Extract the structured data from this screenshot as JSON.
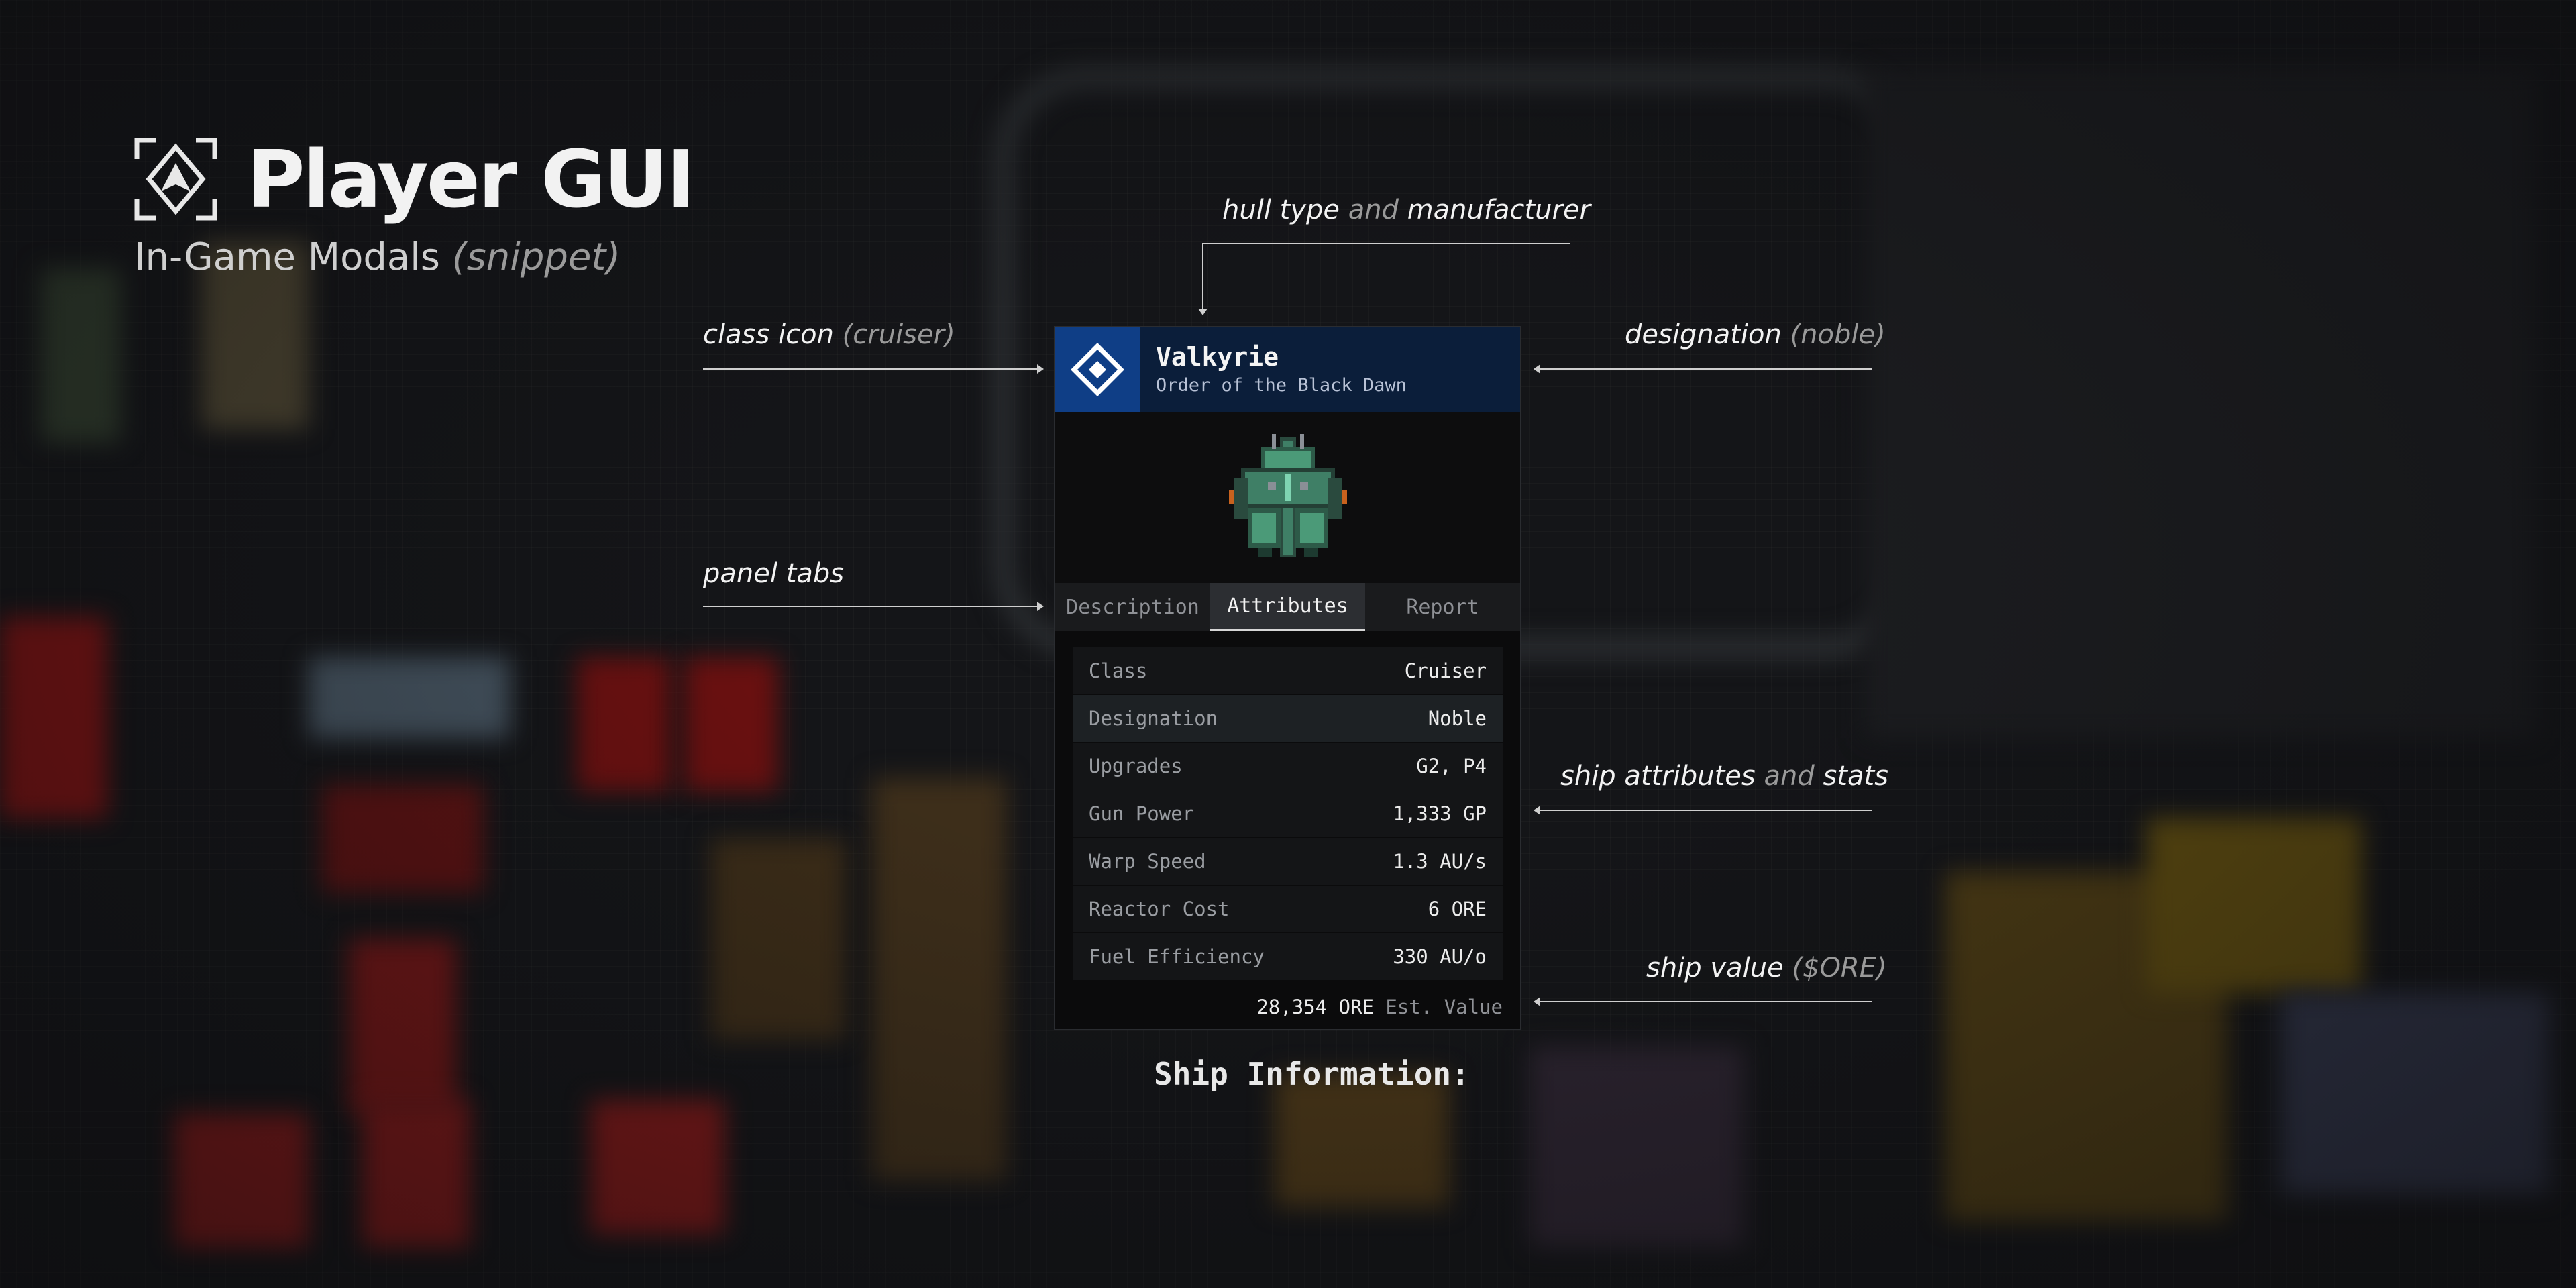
{
  "header": {
    "title": "Player GUI",
    "subtitle_main": "In-Game Modals",
    "subtitle_note": "(snippet)"
  },
  "annotations": {
    "hull": {
      "a": "hull type",
      "b": "and",
      "c": "manufacturer"
    },
    "class_icon": {
      "a": "class icon",
      "b": "(cruiser)"
    },
    "designation": {
      "a": "designation",
      "b": "(noble)"
    },
    "panel_tabs": {
      "a": "panel tabs"
    },
    "attributes": {
      "a": "ship attributes",
      "b": "and",
      "c": "stats"
    },
    "ship_value": {
      "a": "ship value",
      "b": "($ORE)"
    }
  },
  "modal": {
    "ship_name": "Valkyrie",
    "manufacturer": "Order of the Black Dawn",
    "tabs": [
      {
        "label": "Description",
        "active": false
      },
      {
        "label": "Attributes",
        "active": true
      },
      {
        "label": "Report",
        "active": false
      }
    ],
    "attributes": [
      {
        "label": "Class",
        "value": "Cruiser"
      },
      {
        "label": "Designation",
        "value": "Noble"
      },
      {
        "label": "Upgrades",
        "value": "G2, P4"
      },
      {
        "label": "Gun Power",
        "value": "1,333 GP"
      },
      {
        "label": "Warp Speed",
        "value": "1.3 AU/s"
      },
      {
        "label": "Reactor Cost",
        "value": "6 ORE"
      },
      {
        "label": "Fuel Efficiency",
        "value": "330 AU/o"
      }
    ],
    "est_value": "28,354 ORE",
    "est_value_label": "Est. Value"
  },
  "caption": "Ship Information:",
  "icons": {
    "logo": "player-gui-logo-icon",
    "class": "cruiser-diamond-icon",
    "ship": "ship-sprite"
  },
  "colors": {
    "class_icon_bg": "#0f3e86",
    "header_bg": "#0b1e3a",
    "modal_bg": "#0b0b0c",
    "ship_primary": "#3f7f66"
  }
}
